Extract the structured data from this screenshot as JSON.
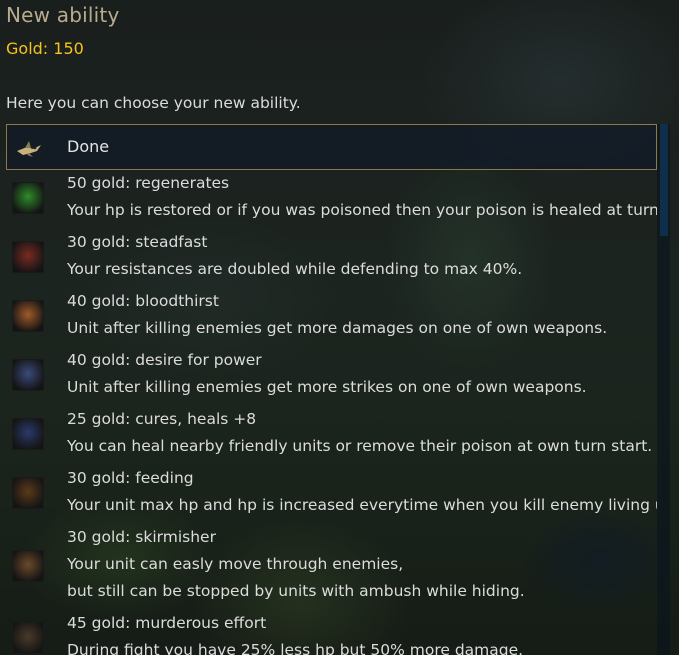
{
  "dialog": {
    "title": "New ability",
    "gold_text": "Gold: 150",
    "hint": "Here you can choose your new ability."
  },
  "done_row": {
    "label": "Done",
    "icon": "flying-creature-icon"
  },
  "abilities": [
    {
      "heading": "50 gold: regenerates",
      "lines": [
        "Your hp is restored or if you was poisoned then your poison is healed at turn star"
      ],
      "icon": "green-potion-icon",
      "color": "#2f8b2a"
    },
    {
      "heading": "30 gold: steadfast",
      "lines": [
        "Your resistances are doubled while defending to max 40%."
      ],
      "icon": "chainmail-icon",
      "color": "#7a2a22"
    },
    {
      "heading": "40 gold: bloodthirst",
      "lines": [
        "Unit after killing enemies get more damages on one of own weapons."
      ],
      "icon": "bloody-axe-icon",
      "color": "#a05a2a"
    },
    {
      "heading": "40 gold: desire for power",
      "lines": [
        "Unit after killing enemies get more strikes on one of own weapons."
      ],
      "icon": "armored-hand-icon",
      "color": "#3a4a7a"
    },
    {
      "heading": "25 gold: cures, heals +8",
      "lines": [
        "You can heal nearby friendly units or remove their poison at own turn start."
      ],
      "icon": "healing-cross-icon",
      "color": "#2a3a6a"
    },
    {
      "heading": "30 gold: feeding",
      "lines": [
        "Your unit max hp and hp is increased everytime when you kill enemy living unit."
      ],
      "icon": "fanged-maw-icon",
      "color": "#5a3a1a"
    },
    {
      "heading": "30 gold: skirmisher",
      "lines": [
        "Your unit can easly move through enemies,",
        "but still can be stopped by units with ambush while hiding."
      ],
      "icon": "hooded-figure-icon",
      "color": "#6a4a2a"
    },
    {
      "heading": "45 gold: murderous effort",
      "lines": [
        "During fight you have 25% less hp but 50% more damage."
      ],
      "icon": "warrior-axe-icon",
      "color": "#4a3a2a"
    }
  ]
}
